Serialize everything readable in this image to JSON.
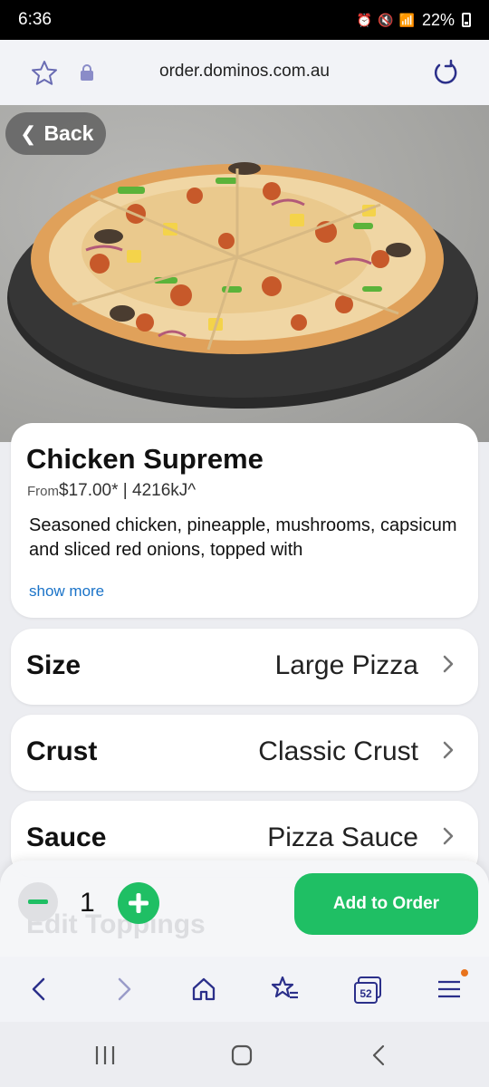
{
  "status_bar": {
    "time": "6:36",
    "battery": "22%"
  },
  "url_bar": {
    "url": "order.dominos.com.au"
  },
  "back_button": {
    "label": "Back"
  },
  "product": {
    "name": "Chicken Supreme",
    "price_prefix": "From",
    "price": "$17.00* | 4216kJ^",
    "description": "Seasoned chicken, pineapple, mushrooms, capsicum and sliced red onions, topped with",
    "show_more": "show more"
  },
  "options": [
    {
      "label": "Size",
      "value": "Large Pizza"
    },
    {
      "label": "Crust",
      "value": "Classic Crust"
    },
    {
      "label": "Sauce",
      "value": "Pizza Sauce"
    }
  ],
  "edit_toppings": "Edit Toppings",
  "order": {
    "quantity": "1",
    "add_label": "Add to Order"
  },
  "browser_nav": {
    "tab_count": "52"
  },
  "colors": {
    "accent_green": "#1fbf64",
    "link_blue": "#1a73c8",
    "nav_icon": "#2b2f8a"
  }
}
